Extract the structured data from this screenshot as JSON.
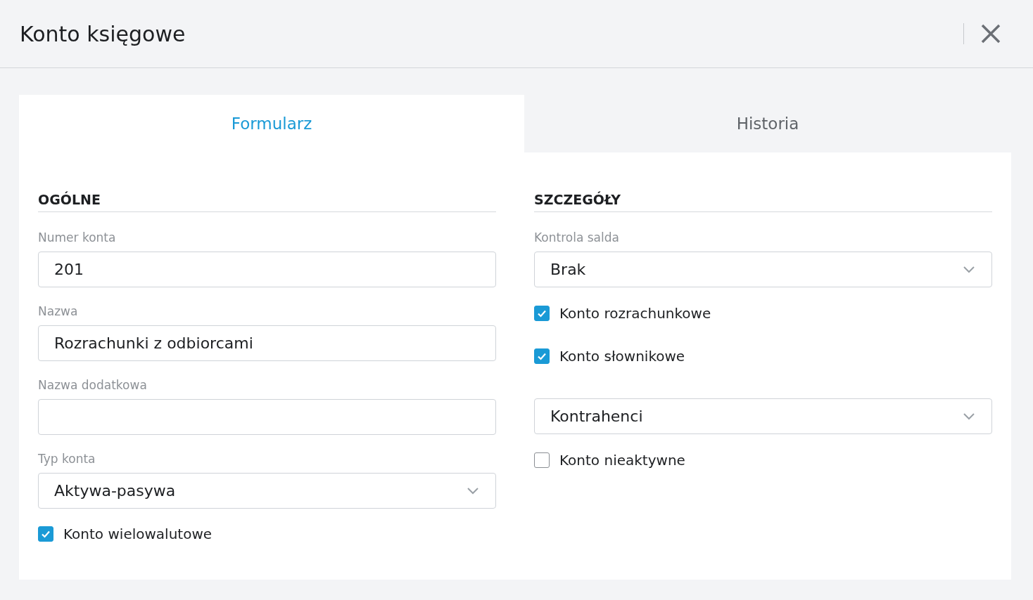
{
  "window": {
    "title": "Konto księgowe"
  },
  "tabs": [
    {
      "label": "Formularz",
      "selected": true
    },
    {
      "label": "Historia",
      "selected": false
    }
  ],
  "sections": [
    {
      "heading": "OGÓLNE",
      "items": [
        {
          "kind": "text",
          "label": "Numer konta",
          "value": "201"
        },
        {
          "kind": "text",
          "label": "Nazwa",
          "value": "Rozrachunki z odbiorcami"
        },
        {
          "kind": "text",
          "label": "Nazwa dodatkowa"
        },
        {
          "kind": "select",
          "label": "Typ konta",
          "value": "Aktywa-pasywa"
        },
        {
          "kind": "checkbox",
          "label": "Konto wielowalutowe",
          "checked": true
        }
      ]
    },
    {
      "heading": "SZCZEGÓŁY",
      "items": [
        {
          "kind": "select",
          "label": "Kontrola salda",
          "value": "Brak"
        },
        {
          "kind": "checkbox",
          "label": "Konto rozrachunkowe",
          "checked": true
        },
        {
          "kind": "checkbox",
          "label": "Konto słownikowe",
          "checked": true
        },
        {
          "kind": "select",
          "value": "Kontrahenci"
        },
        {
          "kind": "checkbox",
          "label": "Konto nieaktywne",
          "checked": false
        }
      ]
    }
  ]
}
